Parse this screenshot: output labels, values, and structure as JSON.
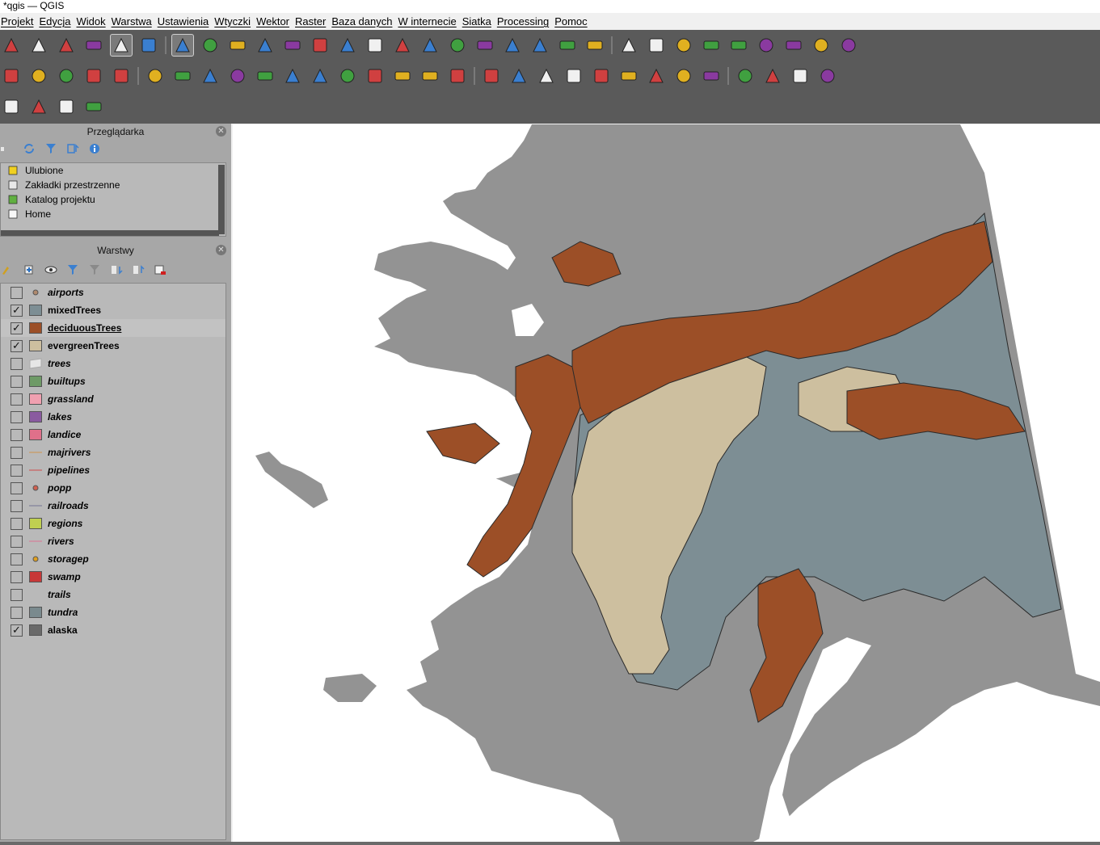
{
  "window": {
    "title": "*qgis — QGIS"
  },
  "menu": [
    "Projekt",
    "Edycja",
    "Widok",
    "Warstwa",
    "Ustawienia",
    "Wtyczki",
    "Wektor",
    "Raster",
    "Baza danych",
    "W internecie",
    "Siatka",
    "Processing",
    "Pomoc"
  ],
  "browser_panel": {
    "title": "Przeglądarka",
    "items": [
      {
        "label": "Ulubione",
        "icon": "star-icon"
      },
      {
        "label": "Zakładki przestrzenne",
        "icon": "bookmark-icon"
      },
      {
        "label": "Katalog projektu",
        "icon": "project-folder-icon"
      },
      {
        "label": "Home",
        "icon": "home-icon"
      }
    ]
  },
  "layers_panel": {
    "title": "Warstwy",
    "layers": [
      {
        "name": "airports",
        "checked": false,
        "symbol": "point",
        "color": "#b08a6e",
        "italic": true
      },
      {
        "name": "mixedTrees",
        "checked": true,
        "symbol": "fill",
        "color": "#7d8e94",
        "italic": false
      },
      {
        "name": "deciduousTrees",
        "checked": true,
        "symbol": "fill",
        "color": "#9c4f27",
        "italic": false,
        "underline": true,
        "selected": true
      },
      {
        "name": "evergreenTrees",
        "checked": true,
        "symbol": "fill",
        "color": "#cdbf9f",
        "italic": false
      },
      {
        "name": "trees",
        "checked": false,
        "symbol": "fill-light",
        "color": "#e6e6e6",
        "italic": true
      },
      {
        "name": "builtups",
        "checked": false,
        "symbol": "fill",
        "color": "#6e9a66",
        "italic": true
      },
      {
        "name": "grassland",
        "checked": false,
        "symbol": "fill",
        "color": "#f0a0b0",
        "italic": true
      },
      {
        "name": "lakes",
        "checked": false,
        "symbol": "fill",
        "color": "#8a5aa0",
        "italic": true
      },
      {
        "name": "landice",
        "checked": false,
        "symbol": "fill",
        "color": "#e0708a",
        "italic": true
      },
      {
        "name": "majrivers",
        "checked": false,
        "symbol": "line",
        "color": "#c8a070",
        "italic": true
      },
      {
        "name": "pipelines",
        "checked": false,
        "symbol": "line",
        "color": "#c87070",
        "italic": true
      },
      {
        "name": "popp",
        "checked": false,
        "symbol": "point",
        "color": "#d06050",
        "italic": true
      },
      {
        "name": "railroads",
        "checked": false,
        "symbol": "line",
        "color": "#8a8aa0",
        "italic": true
      },
      {
        "name": "regions",
        "checked": false,
        "symbol": "fill",
        "color": "#c0d050",
        "italic": true
      },
      {
        "name": "rivers",
        "checked": false,
        "symbol": "line",
        "color": "#d08aa0",
        "italic": true
      },
      {
        "name": "storagep",
        "checked": false,
        "symbol": "point",
        "color": "#e0a020",
        "italic": true
      },
      {
        "name": "swamp",
        "checked": false,
        "symbol": "fill",
        "color": "#c83838",
        "italic": true
      },
      {
        "name": "trails",
        "checked": false,
        "symbol": "none",
        "color": "#b9b9b9",
        "italic": true
      },
      {
        "name": "tundra",
        "checked": false,
        "symbol": "fill",
        "color": "#7a8a8e",
        "italic": true
      },
      {
        "name": "alaska",
        "checked": true,
        "symbol": "fill",
        "color": "#6a6a6a",
        "italic": false
      }
    ]
  },
  "map": {
    "colors": {
      "land": "#939393",
      "water": "#ffffff",
      "deciduous": "#9c4f27",
      "evergreen": "#cdbf9f",
      "mixed": "#7d8e94",
      "outline": "#2a2a2a"
    }
  },
  "toolbar_icons": {
    "row1": [
      "new-project-icon",
      "open-project-icon",
      "save-project-icon",
      "save-as-icon",
      "project-properties-icon",
      "style-manager-icon",
      "pan-icon",
      "pan-to-selection-icon",
      "zoom-in-icon",
      "zoom-out-icon",
      "zoom-full-icon",
      "zoom-layer-icon",
      "zoom-selection-icon",
      "zoom-native-icon",
      "zoom-last-icon",
      "zoom-next-icon",
      "new-map-view-icon",
      "new-3d-view-icon",
      "bookmark-icon",
      "show-bookmarks-icon",
      "temporal-icon",
      "refresh-icon",
      "identify-icon",
      "attribute-table-icon",
      "settings-icon",
      "statistics-icon",
      "field-calc-icon",
      "measure-icon",
      "map-tips-icon",
      "annotation-icon",
      "text-annotation-icon"
    ],
    "row2": [
      "digitize-icon",
      "data-source-icon",
      "vertex-tool-icon",
      "pencil-icon",
      "new-layer-icon",
      "add-feature-icon",
      "edit-pencil-icon",
      "save-edits-icon",
      "rollback-icon",
      "digitize-line-icon",
      "modify-attributes-icon",
      "delete-icon",
      "cut-icon",
      "copy-icon",
      "paste-icon",
      "undo-icon",
      "redo-icon",
      "label-icon",
      "diagram-icon",
      "label-pin-icon",
      "label-show-icon",
      "label-move-icon",
      "label-rotate-icon",
      "label-change-icon",
      "label-tool-icon",
      "label-props-icon",
      "spy-icon",
      "python-icon",
      "map-thumb-icon",
      "help-icon"
    ],
    "row3": [
      "select-feature-icon",
      "select-attribute-icon",
      "deselect-icon",
      "select-location-icon"
    ]
  }
}
